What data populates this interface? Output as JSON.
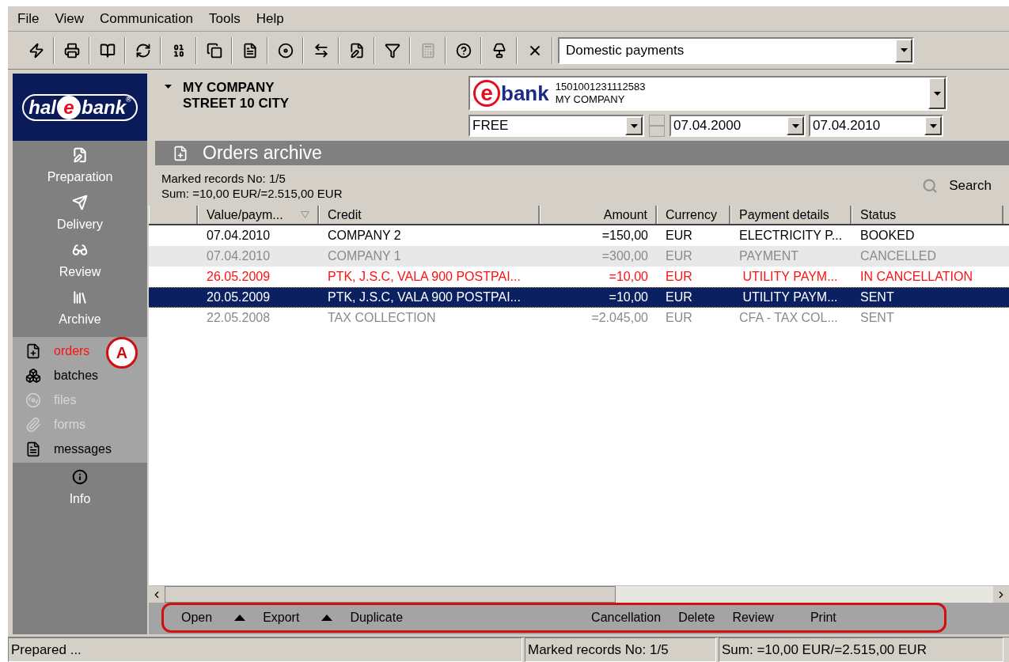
{
  "menu": [
    {
      "label": "File"
    },
    {
      "label": "View"
    },
    {
      "label": "Communication"
    },
    {
      "label": "Tools"
    },
    {
      "label": "Help"
    }
  ],
  "toolbar": [
    {
      "disabled": false
    },
    {
      "disabled": false
    },
    {
      "disabled": false
    },
    {
      "disabled": false
    },
    {
      "disabled": false
    },
    {
      "disabled": false
    },
    {
      "disabled": false
    },
    {
      "disabled": false
    },
    {
      "disabled": false
    },
    {
      "disabled": false
    },
    {
      "disabled": false
    },
    {
      "disabled": true
    },
    {
      "disabled": false
    },
    {
      "disabled": false
    },
    {
      "disabled": false
    }
  ],
  "module_select": {
    "value": "Domestic payments"
  },
  "logo": {
    "left": "hal",
    "mark": "e",
    "right": "bank",
    "reg": "®"
  },
  "sidebar": [
    {
      "label": "Preparation"
    },
    {
      "label": "Delivery"
    },
    {
      "label": "Review"
    },
    {
      "label": "Archive",
      "children": [
        {
          "label": "orders",
          "selected": true,
          "disabled": false
        },
        {
          "label": "batches",
          "selected": false,
          "disabled": false
        },
        {
          "label": "files",
          "selected": false,
          "disabled": true
        },
        {
          "label": "forms",
          "selected": false,
          "disabled": true
        },
        {
          "label": "messages",
          "selected": false,
          "disabled": false
        }
      ]
    },
    {
      "label": "Info"
    }
  ],
  "annotation_badge": "A",
  "company": {
    "name": "MY COMPANY",
    "address": "STREET 10 CITY"
  },
  "account": {
    "logo_mark": "e",
    "logo_text": "bank",
    "number": "1501001231112583",
    "owner": "MY COMPANY"
  },
  "filters": {
    "type": "FREE",
    "date_from": "07.04.2000",
    "date_to": "07.04.2010"
  },
  "title": "Orders archive",
  "summary": {
    "marked": "Marked records No: 1/5",
    "sum": "Sum: =10,00 EUR/=2.515,00 EUR"
  },
  "search": "Search",
  "table": {
    "columns": [
      "Value/paym...",
      "Credit",
      "Amount",
      "Currency",
      "Payment details",
      "Status"
    ],
    "rows": [
      {
        "cells": [
          "07.04.2010",
          "COMPANY 2",
          "=150,00",
          "EUR",
          "ELECTRICITY P...",
          "BOOKED"
        ],
        "kind": "normal",
        "selected": false
      },
      {
        "cells": [
          "07.04.2010",
          "COMPANY 1",
          "=300,00",
          "EUR",
          "PAYMENT",
          "CANCELLED"
        ],
        "kind": "muted",
        "selected": false
      },
      {
        "cells": [
          "26.05.2009",
          "PTK, J.S.C, VALA 900 POSTPAI...",
          "=10,00",
          "EUR",
          " UTILITY PAYM...",
          "IN CANCELLATION"
        ],
        "kind": "alert",
        "selected": false
      },
      {
        "cells": [
          "20.05.2009",
          "PTK, J.S.C, VALA 900 POSTPAI...",
          "=10,00",
          "EUR",
          " UTILITY PAYM...",
          "SENT"
        ],
        "selected": true
      },
      {
        "cells": [
          "22.05.2008",
          "TAX COLLECTION",
          "=2.045,00",
          "EUR",
          "CFA - TAX COL...",
          "SENT"
        ],
        "kind": "muted",
        "selected": false
      }
    ]
  },
  "actions": [
    {
      "label": "Open",
      "kind": "menu"
    },
    {
      "label": "Export",
      "kind": "menu"
    },
    {
      "label": "Duplicate",
      "kind": "plain"
    },
    {
      "label": "Cancellation",
      "kind": "gap"
    },
    {
      "label": "Delete",
      "kind": "plain"
    },
    {
      "label": "Review",
      "kind": "wide"
    },
    {
      "label": "Print",
      "kind": "wide"
    }
  ],
  "status_bar": [
    "Prepared ...",
    "Marked records No: 1/5",
    "Sum: =10,00 EUR/=2.515,00 EUR"
  ]
}
